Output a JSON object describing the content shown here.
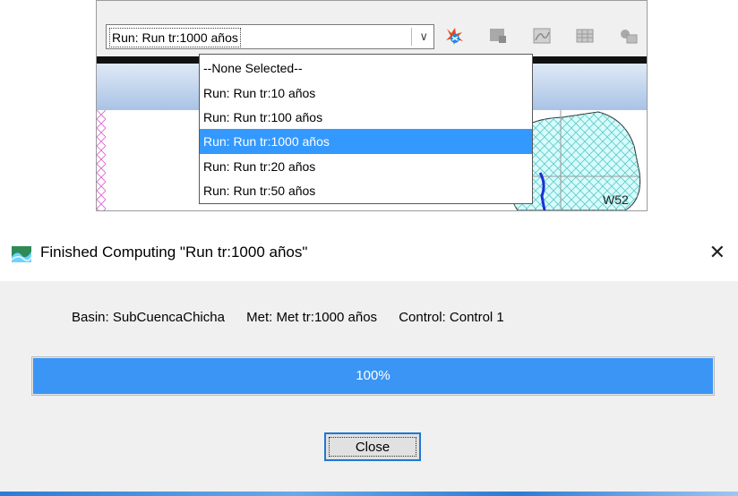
{
  "run_selector": {
    "selected_value": "Run: Run tr:1000 años",
    "options": [
      "--None Selected--",
      "Run: Run tr:10 años",
      "Run: Run tr:100 años",
      "Run: Run tr:1000 años",
      "Run: Run tr:20 años",
      "Run: Run tr:50 años"
    ],
    "highlighted_index": 3
  },
  "toolbar": {
    "icons": [
      "compute-run-icon",
      "global-summary-icon",
      "graph-icon",
      "summary-table-icon",
      "time-series-table-icon"
    ]
  },
  "map": {
    "element_label": "W52"
  },
  "dialog": {
    "title": "Finished Computing \"Run tr:1000 años\"",
    "basin": "Basin: SubCuencaChicha",
    "met": "Met: Met tr:1000 años",
    "control": "Control: Control 1",
    "progress_text": "100%",
    "progress_fraction": 1.0,
    "close_label": "Close"
  },
  "colors": {
    "selection": "#3399ff",
    "progress": "#3b95f5",
    "focus_border": "#1e78d6"
  }
}
